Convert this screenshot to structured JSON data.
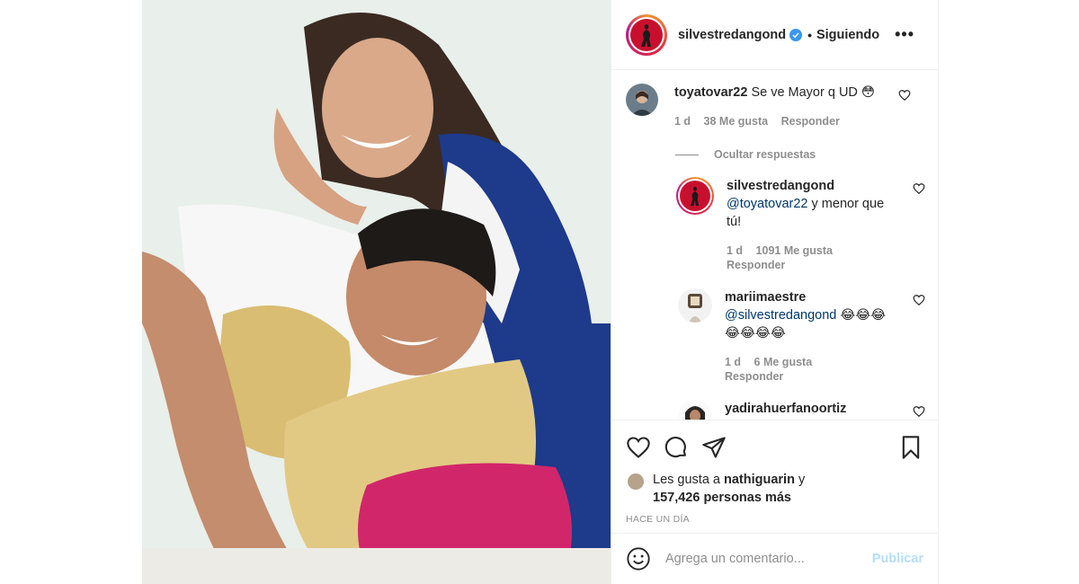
{
  "post": {
    "username": "silvestredangond",
    "dot": "•",
    "following_label": "Siguiendo",
    "more_label": "•••"
  },
  "comments": {
    "main": {
      "username": "toyatovar22",
      "text": "Se ve Mayor q UD 😳",
      "time": "1 d",
      "likes": "38 Me gusta",
      "reply_label": "Responder"
    },
    "hide_replies_label": "Ocultar respuestas",
    "replies": [
      {
        "username": "silvestredangond",
        "mention": "@toyatovar22",
        "text": " y menor que tú!",
        "time": "1 d",
        "likes": "1091 Me gusta",
        "reply_label": "Responder"
      },
      {
        "username": "mariimaestre",
        "mention": "@silvestredangond",
        "text": " 😂😂😂😂😂😂😂",
        "time": "1 d",
        "likes": "6 Me gusta",
        "reply_label": "Responder"
      },
      {
        "username": "yadirahuerfanoortiz"
      }
    ]
  },
  "actions": {
    "likes_prefix": "Les gusta a ",
    "likes_user": "nathiguarin",
    "likes_conj": " y",
    "likes_count": "157,426 personas más",
    "timestamp": "HACE UN DÍA"
  },
  "add_comment": {
    "placeholder": "Agrega un comentario...",
    "publish_label": "Publicar"
  },
  "colors": {
    "verified": "#3897f0",
    "link": "#00376b",
    "muted": "#8e8e8e",
    "publish_disabled": "#b2dffc"
  },
  "icons": [
    "heart-icon",
    "comment-icon",
    "share-icon",
    "save-icon",
    "emoji-icon",
    "more-icon",
    "verified-badge-icon"
  ]
}
